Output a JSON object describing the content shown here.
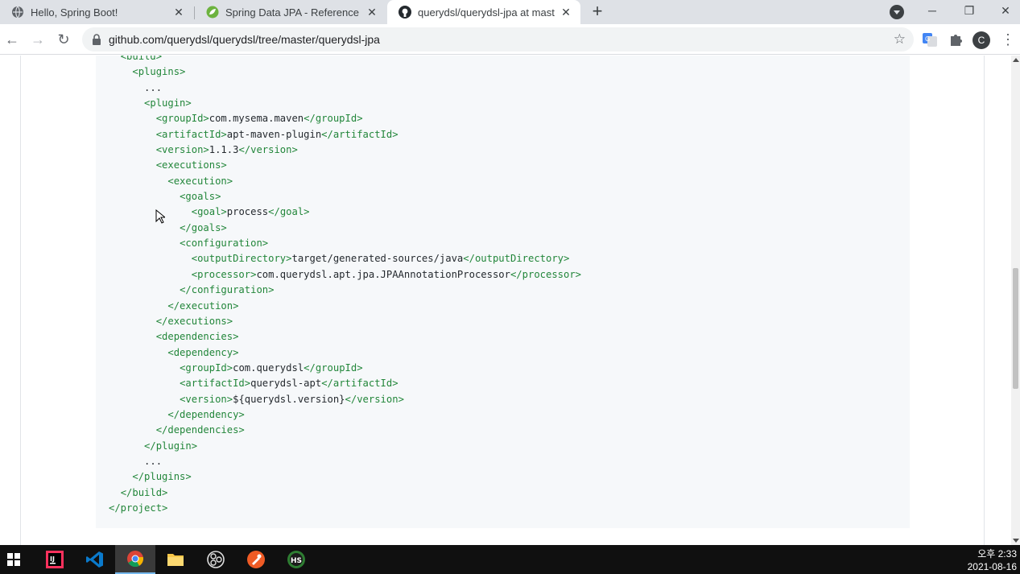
{
  "browser": {
    "tabs": [
      {
        "title": "Hello, Spring Boot!",
        "icon": "globe-icon",
        "active": false
      },
      {
        "title": "Spring Data JPA - Reference Do",
        "icon": "spring-leaf-icon",
        "active": false
      },
      {
        "title": "querydsl/querydsl-jpa at master",
        "icon": "github-icon",
        "active": true
      }
    ],
    "close_glyph": "✕",
    "new_tab_glyph": "+",
    "window_controls": {
      "minimize": "─",
      "restore": "❐",
      "close": "✕"
    },
    "toolbar": {
      "back_glyph": "←",
      "forward_glyph": "→",
      "reload_glyph": "↻",
      "url": "github.com/querydsl/querydsl/tree/master/querydsl-jpa",
      "bookmark_glyph": "☆",
      "profile_initial": "C",
      "menu_glyph": "⋮"
    }
  },
  "code_lines": [
    {
      "indent": "  ",
      "parts": [
        {
          "t": "tag",
          "v": "<build>"
        }
      ]
    },
    {
      "indent": "    ",
      "parts": [
        {
          "t": "tag",
          "v": "<plugins>"
        }
      ]
    },
    {
      "indent": "      ",
      "parts": [
        {
          "t": "txt",
          "v": "..."
        }
      ]
    },
    {
      "indent": "      ",
      "parts": [
        {
          "t": "tag",
          "v": "<plugin>"
        }
      ]
    },
    {
      "indent": "        ",
      "parts": [
        {
          "t": "tag",
          "v": "<groupId>"
        },
        {
          "t": "txt",
          "v": "com.mysema.maven"
        },
        {
          "t": "tag",
          "v": "</groupId>"
        }
      ]
    },
    {
      "indent": "        ",
      "parts": [
        {
          "t": "tag",
          "v": "<artifactId>"
        },
        {
          "t": "txt",
          "v": "apt-maven-plugin"
        },
        {
          "t": "tag",
          "v": "</artifactId>"
        }
      ]
    },
    {
      "indent": "        ",
      "parts": [
        {
          "t": "tag",
          "v": "<version>"
        },
        {
          "t": "txt",
          "v": "1.1.3"
        },
        {
          "t": "tag",
          "v": "</version>"
        }
      ]
    },
    {
      "indent": "        ",
      "parts": [
        {
          "t": "tag",
          "v": "<executions>"
        }
      ]
    },
    {
      "indent": "          ",
      "parts": [
        {
          "t": "tag",
          "v": "<execution>"
        }
      ]
    },
    {
      "indent": "            ",
      "parts": [
        {
          "t": "tag",
          "v": "<goals>"
        }
      ]
    },
    {
      "indent": "              ",
      "parts": [
        {
          "t": "tag",
          "v": "<goal>"
        },
        {
          "t": "txt",
          "v": "process"
        },
        {
          "t": "tag",
          "v": "</goal>"
        }
      ]
    },
    {
      "indent": "            ",
      "parts": [
        {
          "t": "tag",
          "v": "</goals>"
        }
      ]
    },
    {
      "indent": "            ",
      "parts": [
        {
          "t": "tag",
          "v": "<configuration>"
        }
      ]
    },
    {
      "indent": "              ",
      "parts": [
        {
          "t": "tag",
          "v": "<outputDirectory>"
        },
        {
          "t": "txt",
          "v": "target/generated-sources/java"
        },
        {
          "t": "tag",
          "v": "</outputDirectory>"
        }
      ]
    },
    {
      "indent": "              ",
      "parts": [
        {
          "t": "tag",
          "v": "<processor>"
        },
        {
          "t": "txt",
          "v": "com.querydsl.apt.jpa.JPAAnnotationProcessor"
        },
        {
          "t": "tag",
          "v": "</processor>"
        }
      ]
    },
    {
      "indent": "            ",
      "parts": [
        {
          "t": "tag",
          "v": "</configuration>"
        }
      ]
    },
    {
      "indent": "          ",
      "parts": [
        {
          "t": "tag",
          "v": "</execution>"
        }
      ]
    },
    {
      "indent": "        ",
      "parts": [
        {
          "t": "tag",
          "v": "</executions>"
        }
      ]
    },
    {
      "indent": "        ",
      "parts": [
        {
          "t": "tag",
          "v": "<dependencies>"
        }
      ]
    },
    {
      "indent": "          ",
      "parts": [
        {
          "t": "tag",
          "v": "<dependency>"
        }
      ]
    },
    {
      "indent": "            ",
      "parts": [
        {
          "t": "tag",
          "v": "<groupId>"
        },
        {
          "t": "txt",
          "v": "com.querydsl"
        },
        {
          "t": "tag",
          "v": "</groupId>"
        }
      ]
    },
    {
      "indent": "            ",
      "parts": [
        {
          "t": "tag",
          "v": "<artifactId>"
        },
        {
          "t": "txt",
          "v": "querydsl-apt"
        },
        {
          "t": "tag",
          "v": "</artifactId>"
        }
      ]
    },
    {
      "indent": "            ",
      "parts": [
        {
          "t": "tag",
          "v": "<version>"
        },
        {
          "t": "txt",
          "v": "${querydsl.version}"
        },
        {
          "t": "tag",
          "v": "</version>"
        }
      ]
    },
    {
      "indent": "          ",
      "parts": [
        {
          "t": "tag",
          "v": "</dependency>"
        }
      ]
    },
    {
      "indent": "        ",
      "parts": [
        {
          "t": "tag",
          "v": "</dependencies>"
        }
      ]
    },
    {
      "indent": "      ",
      "parts": [
        {
          "t": "tag",
          "v": "</plugin>"
        }
      ]
    },
    {
      "indent": "      ",
      "parts": [
        {
          "t": "txt",
          "v": "..."
        }
      ]
    },
    {
      "indent": "    ",
      "parts": [
        {
          "t": "tag",
          "v": "</plugins>"
        }
      ]
    },
    {
      "indent": "  ",
      "parts": [
        {
          "t": "tag",
          "v": "</build>"
        }
      ]
    },
    {
      "indent": "",
      "parts": [
        {
          "t": "tag",
          "v": "</project>"
        }
      ]
    }
  ],
  "taskbar": {
    "apps": [
      {
        "name": "windows-start-icon",
        "active": false
      },
      {
        "name": "intellij-idea-icon",
        "active": false
      },
      {
        "name": "vscode-icon",
        "active": false
      },
      {
        "name": "chrome-icon",
        "active": true
      },
      {
        "name": "file-explorer-icon",
        "active": false
      },
      {
        "name": "obs-studio-icon",
        "active": false
      },
      {
        "name": "postman-icon",
        "active": false
      },
      {
        "name": "heidisql-icon",
        "active": false
      }
    ],
    "clock": {
      "time": "오후 2:33",
      "date": "2021-08-16"
    }
  },
  "colors": {
    "xml_tag": "#22863a",
    "code_text": "#24292e",
    "code_bg": "#f6f8fa",
    "tab_strip": "#dee1e6",
    "taskbar": "#101010"
  }
}
